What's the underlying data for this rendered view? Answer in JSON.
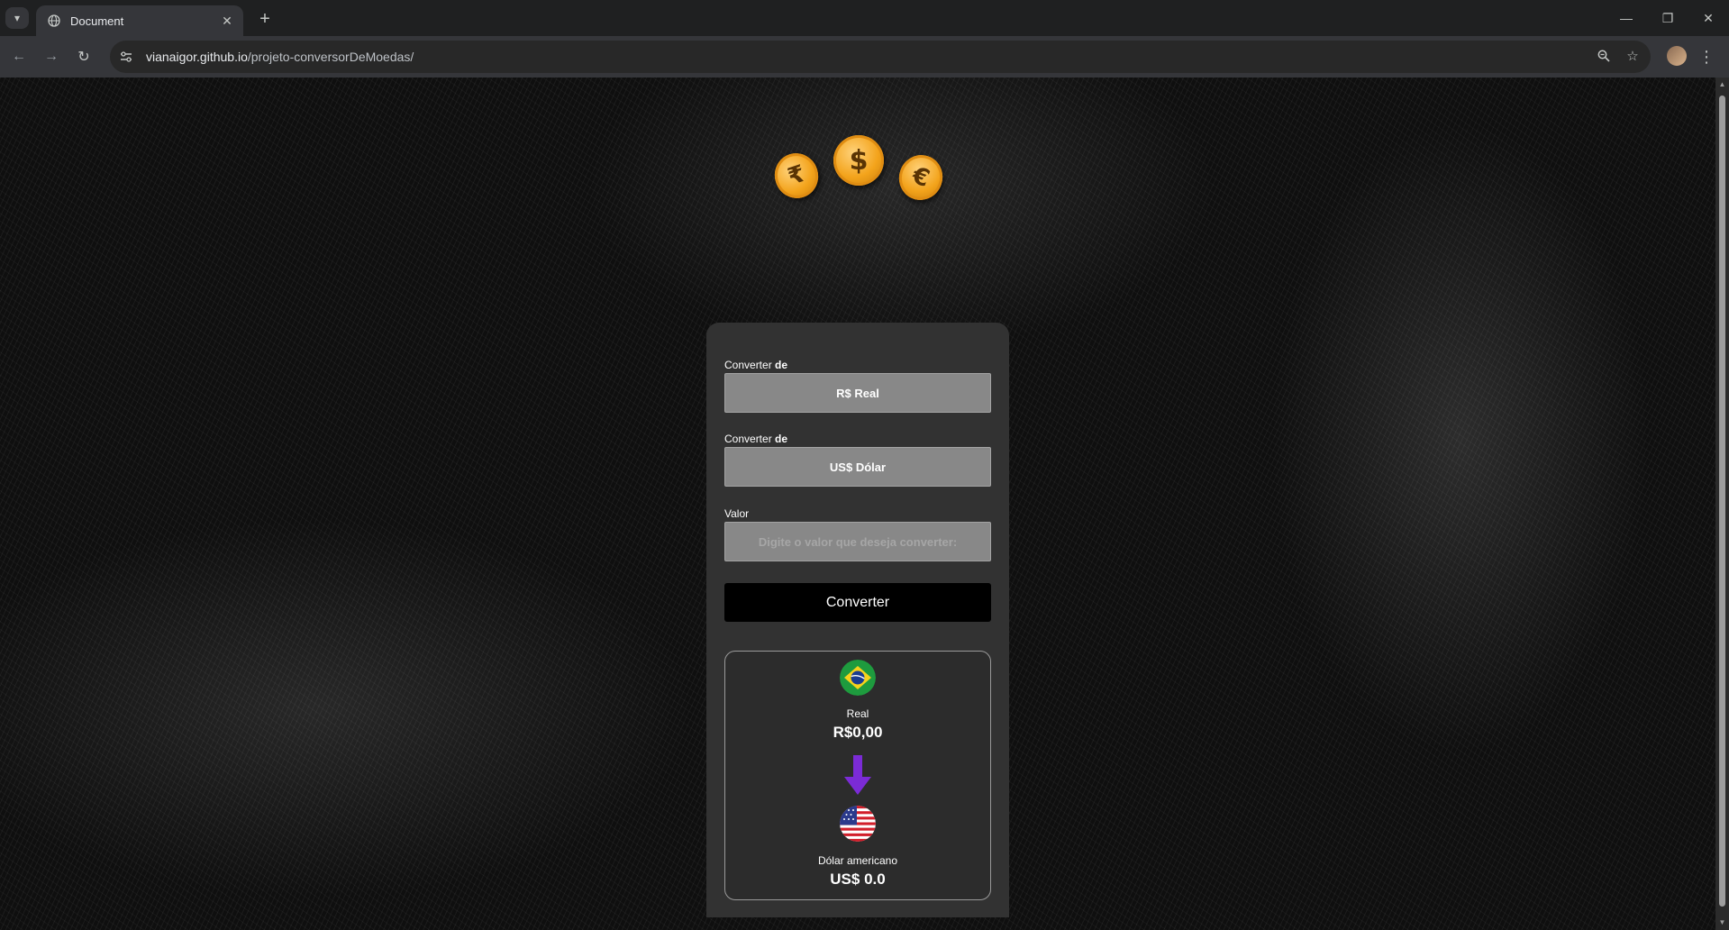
{
  "browser": {
    "tab_title": "Document",
    "url_host": "vianaigor.github.io",
    "url_path": "/projeto-conversorDeMoedas/"
  },
  "icons": {
    "coins": [
      "rupee-coin-icon",
      "dollar-coin-icon",
      "euro-coin-icon"
    ],
    "arrow": "arrow-down-icon",
    "flags": [
      "brazil-flag-icon",
      "usa-flag-icon"
    ]
  },
  "colors": {
    "coin": "#f3a31b",
    "arrow": "#7b2bd6",
    "button": "#000000",
    "card": "#323232"
  },
  "form": {
    "from_label_prefix": "Converter ",
    "from_label_bold": "de",
    "from_value": "R$ Real",
    "to_label_prefix": "Converter ",
    "to_label_bold": "de",
    "to_value": "US$ Dólar",
    "value_label": "Valor",
    "value_placeholder": "Digite o valor que deseja converter:",
    "value_current": "",
    "convert_button": "Converter"
  },
  "result": {
    "from_name": "Real",
    "from_value": "R$0,00",
    "to_name": "Dólar americano",
    "to_value": "US$ 0.0"
  }
}
